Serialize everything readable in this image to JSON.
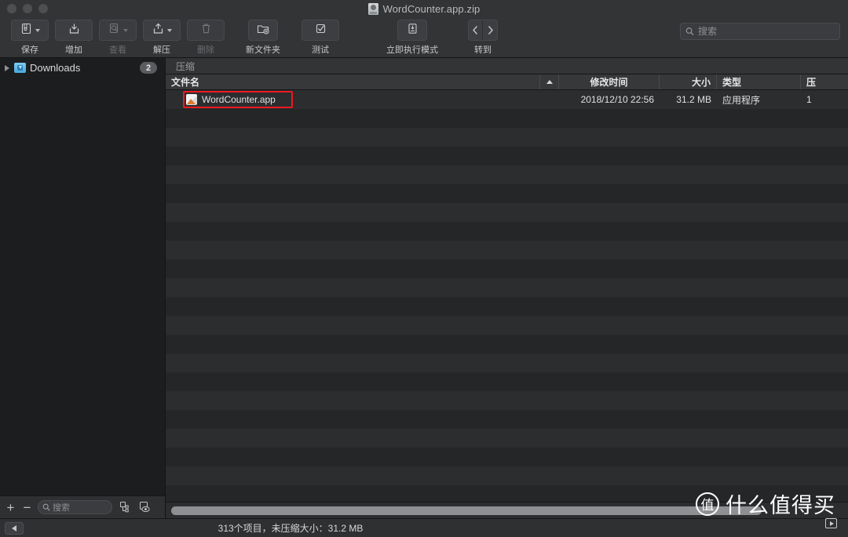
{
  "window": {
    "title": "WordCounter.app.zip",
    "title_icon": "zip-file-icon",
    "traffic_lights": [
      "close",
      "minimize",
      "maximize"
    ]
  },
  "toolbar": {
    "items": [
      {
        "label": "保存",
        "icon": "archive-save-icon",
        "enabled": true,
        "has_menu": true
      },
      {
        "label": "增加",
        "icon": "add-to-archive-icon",
        "enabled": true,
        "has_menu": false
      },
      {
        "label": "查看",
        "icon": "preview-search-icon",
        "enabled": false,
        "has_menu": true
      },
      {
        "label": "解压",
        "icon": "extract-icon",
        "enabled": true,
        "has_menu": true
      },
      {
        "label": "删除",
        "icon": "trash-icon",
        "enabled": false,
        "has_menu": false
      },
      {
        "label": "新文件夹",
        "icon": "new-folder-icon",
        "enabled": true,
        "has_menu": false
      },
      {
        "label": "测试",
        "icon": "test-checkmark-icon",
        "enabled": true,
        "has_menu": false
      }
    ],
    "run_mode": {
      "label": "立即执行模式",
      "icon": "instant-run-icon",
      "enabled": true
    },
    "navigate": {
      "label": "转到",
      "back_icon": "chevron-left-icon",
      "forward_icon": "chevron-right-icon"
    },
    "search": {
      "placeholder": "搜索",
      "value": "",
      "icon": "search-icon"
    }
  },
  "sidebar": {
    "items": [
      {
        "label": "Downloads",
        "icon": "downloads-folder-icon",
        "badge": "2",
        "expanded": false
      }
    ],
    "bottom": {
      "add_label": "+",
      "remove_label": "−",
      "search_placeholder": "搜索",
      "icons": [
        "file-structure-icon",
        "preview-eye-icon"
      ]
    }
  },
  "main": {
    "breadcrumb": "压缩",
    "columns": [
      {
        "key": "name",
        "label": "文件名",
        "sorted": false
      },
      {
        "key": "mtime",
        "label": "修改时间",
        "sorted": true,
        "direction": "asc"
      },
      {
        "key": "size",
        "label": "大小",
        "sorted": false
      },
      {
        "key": "type",
        "label": "类型",
        "sorted": false
      },
      {
        "key": "last",
        "label": "压",
        "sorted": false
      }
    ],
    "rows": [
      {
        "name": "WordCounter.app",
        "icon": "app-bundle-icon",
        "mtime": "2018/12/10 22:56",
        "size": "31.2 MB",
        "type": "应用程序",
        "last": "1",
        "highlighted": true
      }
    ],
    "empty_row_count": 21,
    "scrollbar": {
      "orientation": "horizontal",
      "thumb_percent": 88
    }
  },
  "statusbar": {
    "collapse_icon": "collapse-sidebar-icon",
    "text": "313个项目，未压缩大小：31.2 MB"
  },
  "watermark": {
    "logo_char": "值",
    "text": "什么值得买"
  },
  "colors": {
    "window_bg": "#252729",
    "titlebar": "#323436",
    "sidebar": "#1c1d1f",
    "row_odd": "#2b2d2f",
    "row_even": "#242628",
    "highlight": "#ee1b20",
    "accent_folder": "#4aa8db"
  }
}
